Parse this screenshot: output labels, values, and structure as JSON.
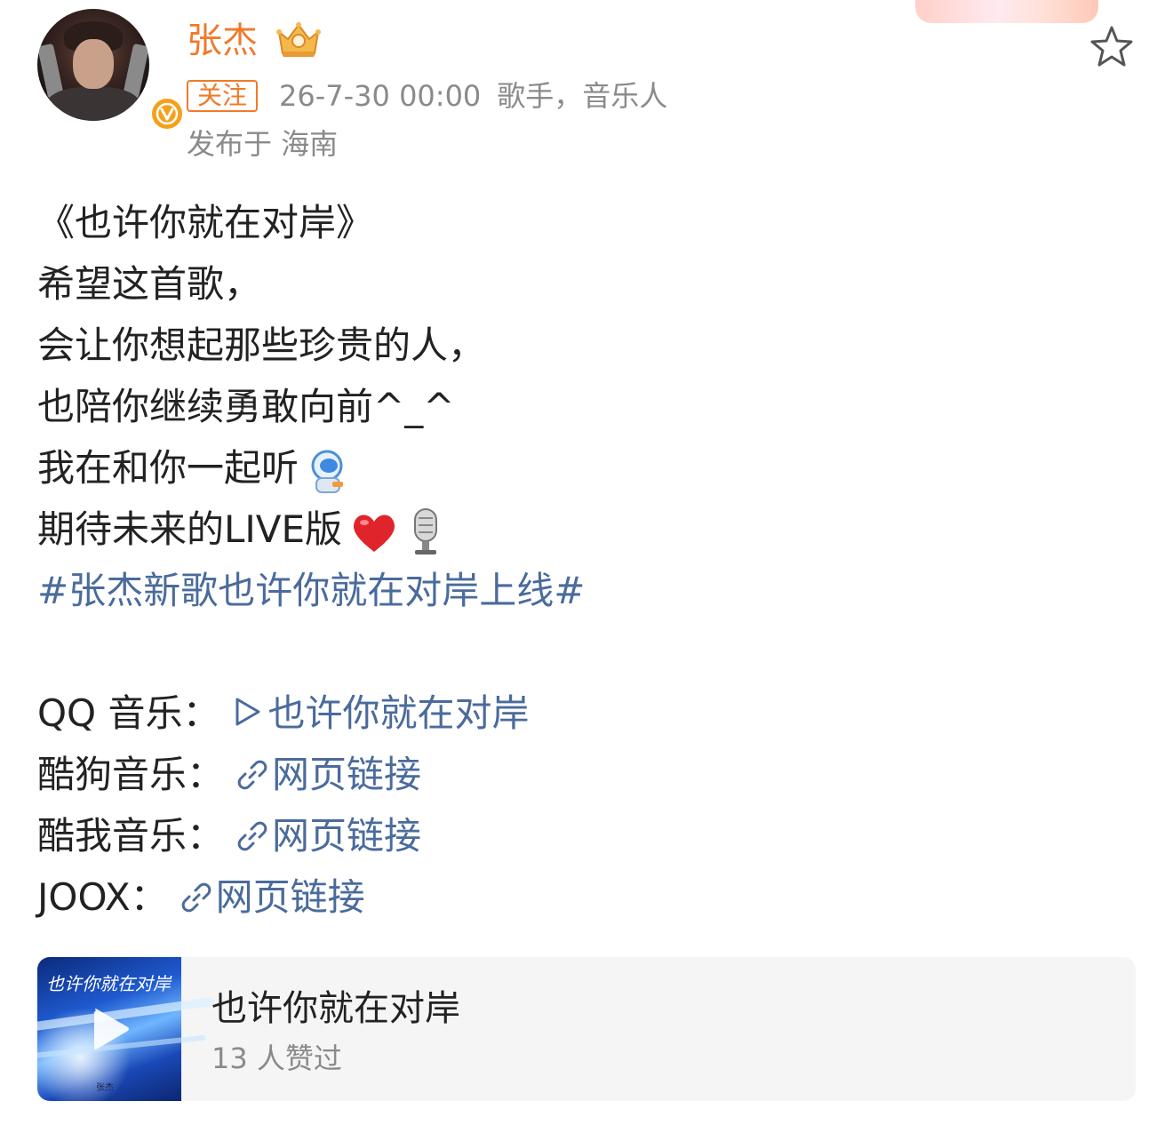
{
  "post_header": {
    "username": "张杰",
    "follow_label": "关注",
    "timestamp": "26-7-30 00:00",
    "author_tag": "歌手，音乐人",
    "location": "发布于 海南",
    "username_color": "#f07a2b"
  },
  "post_body": {
    "lines": [
      "《也许你就在对岸》",
      "希望这首歌，",
      "会让你想起那些珍贵的人，",
      "也陪你继续勇敢向前^_^",
      "我在和你一起听",
      "期待未来的LIVE版"
    ],
    "hashtag": "#张杰新歌也许你就在对岸上线#",
    "emoji_icons": [
      "astronaut-emoji",
      "heart-emoji",
      "microphone-emoji"
    ],
    "links": [
      {
        "label": "QQ 音乐：",
        "icon": "play-icon",
        "text": "也许你就在对岸"
      },
      {
        "label": "酷狗音乐：",
        "icon": "link-icon",
        "text": "网页链接"
      },
      {
        "label": "酷我音乐：",
        "icon": "link-icon",
        "text": "网页链接"
      },
      {
        "label": "JOOX：",
        "icon": "link-icon",
        "text": "网页链接"
      }
    ],
    "link_color": "#4a6b9c"
  },
  "music_card": {
    "title": "也许你就在对岸",
    "likes": "13 人赞过",
    "cover_title": "也许你就在对岸",
    "cover_artist": "张杰"
  }
}
